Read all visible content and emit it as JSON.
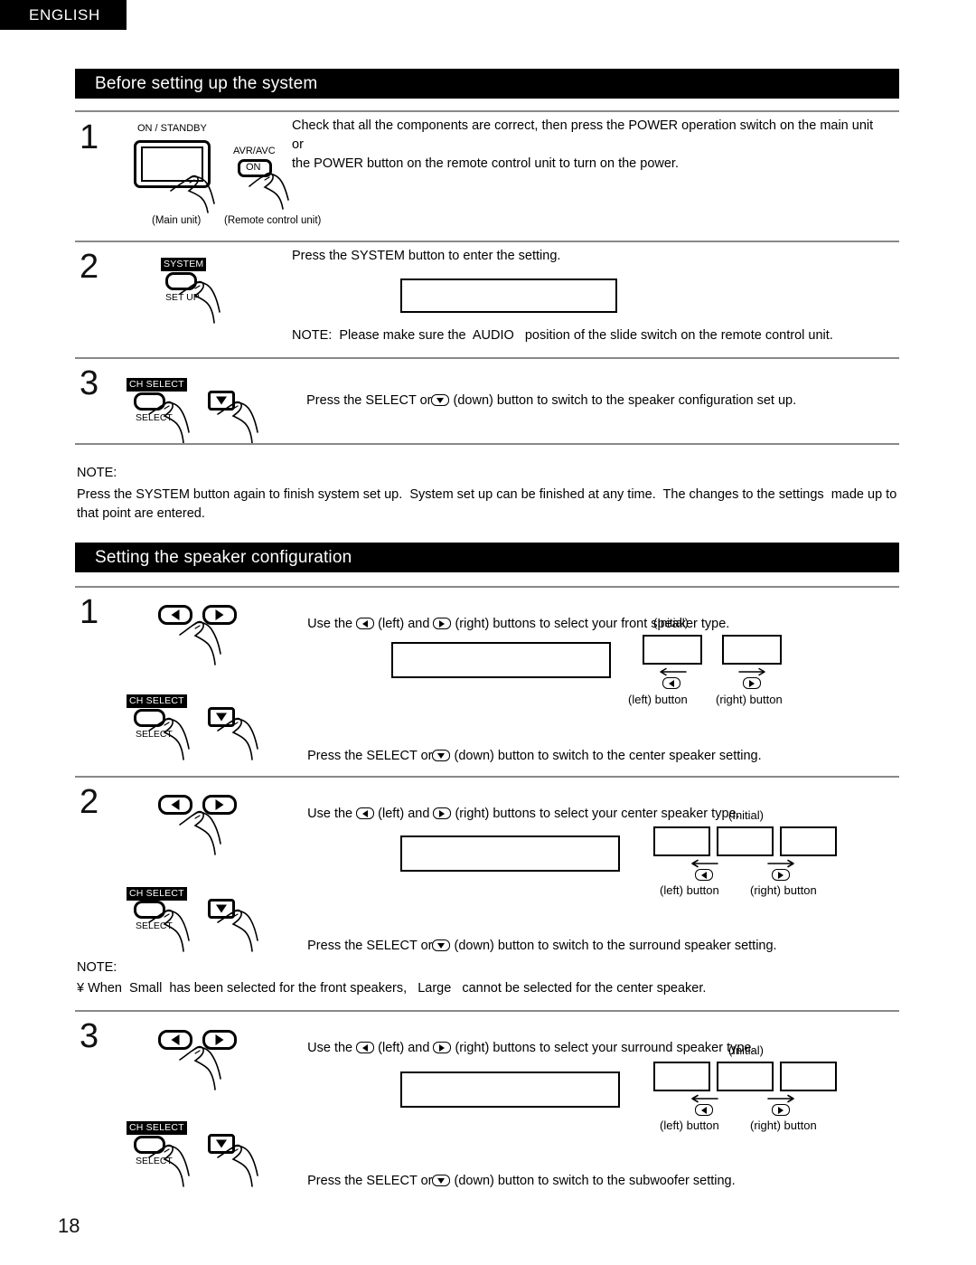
{
  "page": {
    "language_tab": "ENGLISH",
    "page_number": "18"
  },
  "sections": [
    {
      "heading": "Before setting up the system",
      "steps": [
        {
          "number": "1",
          "text": "Check that all the components are correct, then press the POWER operation switch on the main unit or\nthe POWER button on the remote control unit to turn on the power.",
          "illustration": {
            "main_unit_label": "ON / STANDBY",
            "main_unit_caption": "(Main unit)",
            "remote_label": "AVR/AVC",
            "remote_button_text": "ON",
            "remote_caption": "(Remote control unit)"
          }
        },
        {
          "number": "2",
          "text": "Press the SYSTEM button to enter the setting.",
          "note": "NOTE:  Please make sure the  AUDIO   position of the slide switch on the remote control unit.",
          "illustration": {
            "chip_label": "SYSTEM",
            "sub_label": "SET UP"
          }
        },
        {
          "number": "3",
          "text_before": "Press the SELECT or",
          "text_after": "(down) button to switch to the speaker configuration set up.",
          "illustration": {
            "chip_label": "CH SELECT",
            "sub_label": "SELECT"
          }
        }
      ],
      "note_heading": "NOTE:",
      "note_body": "Press the SYSTEM button again to finish system set up.  System set up can be finished at any time.  The changes to the settings  made up to\nthat point are entered."
    },
    {
      "heading": "Setting the speaker configuration",
      "steps": [
        {
          "number": "1",
          "use_text_before": "Use the",
          "use_text_mid": "(left) and",
          "use_text_after": "(right) buttons to select your front speaker type.",
          "initial_label": "(Initial)",
          "left_button_caption": "(left) button",
          "right_button_caption": "(right) button",
          "box_count": 2,
          "press_text_before": "Press the SELECT or",
          "press_text_after": "(down) button to switch to the center speaker setting.",
          "chip_label": "CH SELECT",
          "sub_label": "SELECT"
        },
        {
          "number": "2",
          "use_text_before": "Use the",
          "use_text_mid": "(left) and",
          "use_text_after": "(right) buttons to select your center speaker type.",
          "initial_label": "(Initial)",
          "left_button_caption": "(left) button",
          "right_button_caption": "(right) button",
          "box_count": 3,
          "press_text_before": "Press the SELECT or",
          "press_text_after": "(down) button to switch to the surround speaker setting.",
          "chip_label": "CH SELECT",
          "sub_label": "SELECT",
          "note_heading": "NOTE:",
          "note_body": "¥ When  Small  has been selected for the front speakers,   Large   cannot be selected for the center speaker."
        },
        {
          "number": "3",
          "use_text_before": "Use the",
          "use_text_mid": "(left) and",
          "use_text_after": "(right) buttons to select your surround speaker type.",
          "initial_label": "(Initial)",
          "left_button_caption": "(left) button",
          "right_button_caption": "(right) button",
          "box_count": 3,
          "press_text_before": "Press the SELECT or",
          "press_text_after": "(down) button to switch to the subwoofer setting.",
          "chip_label": "CH SELECT",
          "sub_label": "SELECT"
        }
      ]
    }
  ],
  "colors": {
    "bar_background": "#000000",
    "bar_text": "#ffffff",
    "page_background": "#ffffff",
    "rule": "#888888"
  }
}
